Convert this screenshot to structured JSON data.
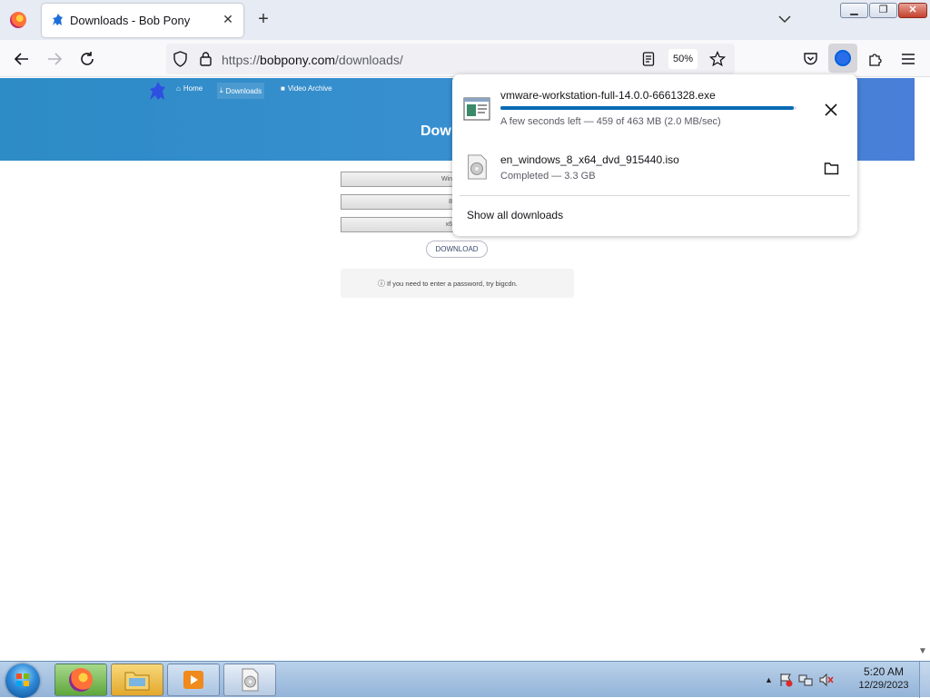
{
  "browser": {
    "tab": {
      "title": "Downloads - Bob Pony",
      "close_label": "✕"
    },
    "new_tab_label": "+",
    "url": {
      "scheme": "https://",
      "host": "bobpony.com",
      "path": "/downloads/"
    },
    "zoom": "50%"
  },
  "site": {
    "nav": [
      {
        "label": "Home",
        "icon": "home-icon"
      },
      {
        "label": "Downloads",
        "icon": "download-icon"
      },
      {
        "label": "Video Archive",
        "icon": "video-icon"
      }
    ],
    "hero_title": "Dow",
    "fields": [
      "Win",
      "8",
      "x6"
    ],
    "download_button": "DOWNLOAD",
    "hint": "If you need to enter a password, try bigcdn."
  },
  "downloads_panel": {
    "items": [
      {
        "name": "vmware-workstation-full-14.0.0-6661328.exe",
        "status": "A few seconds left — 459 of 463 MB (2.0 MB/sec)",
        "progress": 0.99,
        "action": "cancel",
        "icon": "exe-file-icon"
      },
      {
        "name": "en_windows_8_x64_dvd_915440.iso",
        "status": "Completed — 3.3 GB",
        "action": "show-in-folder",
        "icon": "disc-image-icon"
      }
    ],
    "show_all_label": "Show all downloads"
  },
  "taskbar": {
    "time": "5:20 AM",
    "date": "12/29/2023",
    "apps": [
      "firefox",
      "windows-explorer",
      "media-player",
      "disc-image"
    ]
  },
  "colors": {
    "site_header": "#2d8bc5",
    "progress": "#0a6bb5",
    "accent": "#0061e0"
  }
}
